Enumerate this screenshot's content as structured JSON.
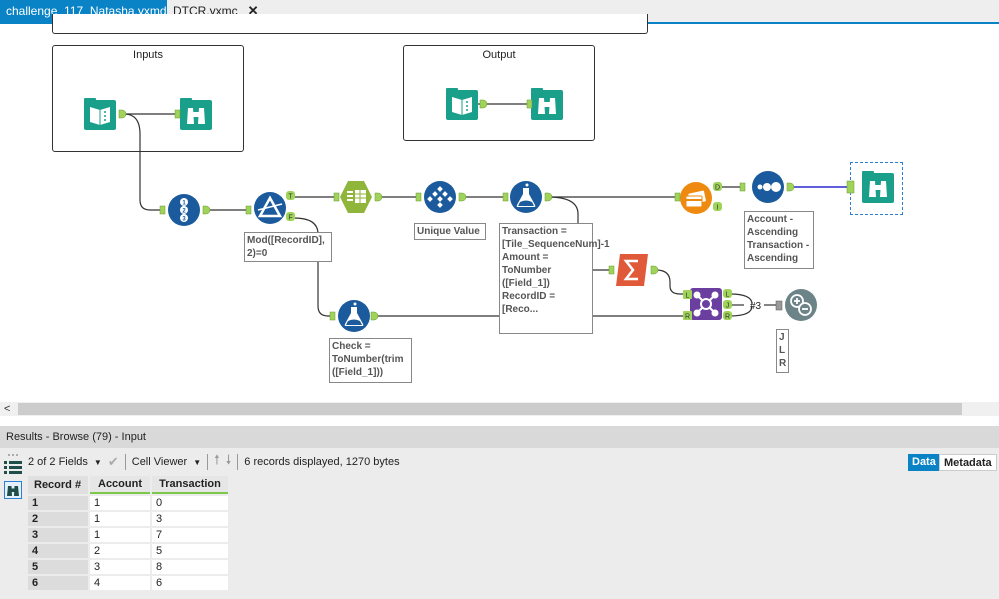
{
  "tabs": [
    {
      "label": "challenge_117_Natasha.yxmd",
      "active": true,
      "close": "✕"
    },
    {
      "label": "DTCR.yxmc",
      "active": false,
      "close": "✕"
    }
  ],
  "canvas": {
    "containers": [
      {
        "title": "Inputs"
      },
      {
        "title": "Output"
      }
    ],
    "tools": {
      "input_inputs": {
        "type": "input-data",
        "color": "#1aa08a"
      },
      "browse_inputs": {
        "type": "browse",
        "color": "#1aa08a"
      },
      "input_output": {
        "type": "input-data",
        "color": "#1aa08a"
      },
      "browse_output": {
        "type": "browse",
        "color": "#1aa08a"
      },
      "record_id": {
        "type": "record-id",
        "color": "#1b5a9c"
      },
      "filter": {
        "type": "filter",
        "color": "#1b5a9c",
        "ports": [
          "T",
          "F"
        ]
      },
      "text_to_columns": {
        "type": "text-to-columns",
        "color": "#8fb53a"
      },
      "unique": {
        "type": "unique",
        "color": "#1b5a9c"
      },
      "formula_top": {
        "type": "formula",
        "color": "#1b5a9c"
      },
      "formula_bottom": {
        "type": "formula",
        "color": "#1b5a9c"
      },
      "summarize": {
        "type": "summarize",
        "color": "#e05a3a"
      },
      "tile": {
        "type": "tile",
        "color": "#ef8a10",
        "ports": [
          "D",
          "I"
        ]
      },
      "sort": {
        "type": "sort",
        "color": "#1b5a9c"
      },
      "browse_final": {
        "type": "browse",
        "color": "#1aa08a"
      },
      "join": {
        "type": "join",
        "color": "#6b3fa0",
        "in_ports": [
          "L",
          "R"
        ],
        "out_ports": [
          "L",
          "J",
          "R"
        ]
      },
      "union": {
        "type": "union",
        "color": "#6c8388"
      }
    },
    "annotations": {
      "filter": "Mod([RecordID], 2)=0",
      "unique": "Unique Value",
      "formula_top": "Transaction = [Tile_SequenceNum]-1 Amount = ToNumber ([Field_1]) RecordID = [Reco...",
      "formula_bottom": "Check = ToNumber(trim ([Field_1]))",
      "sort": "Account - Ascending Transaction - Ascending",
      "union": "J L R",
      "union_connection_label": "#3"
    }
  },
  "scrollbar": {
    "left_arrow": "<"
  },
  "results": {
    "title": "Results - Browse (79) - Input",
    "fields_selector": "2 of 2 Fields",
    "cell_viewer": "Cell Viewer",
    "status": "6 records displayed, 1270 bytes",
    "view_tabs": [
      {
        "label": "Data",
        "active": true
      },
      {
        "label": "Metadata",
        "active": false
      }
    ],
    "table": {
      "columns": [
        "Record #",
        "Account",
        "Transaction"
      ],
      "rows": [
        [
          "1",
          "1",
          "0"
        ],
        [
          "2",
          "1",
          "3"
        ],
        [
          "3",
          "1",
          "7"
        ],
        [
          "4",
          "2",
          "5"
        ],
        [
          "5",
          "3",
          "8"
        ],
        [
          "6",
          "4",
          "6"
        ]
      ]
    }
  },
  "colors": {
    "accent": "#0a83c6",
    "anchor_green": "#9fd35a",
    "selected_connection": "#2b2bd0"
  }
}
